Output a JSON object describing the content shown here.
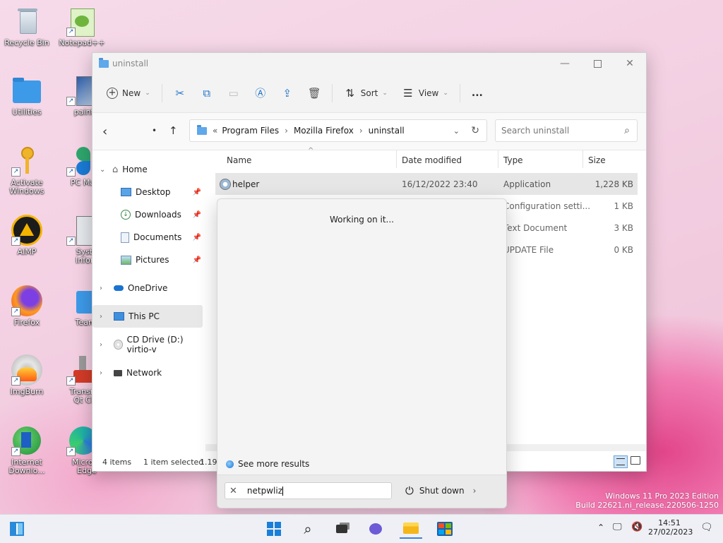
{
  "desktop": {
    "icons": [
      {
        "label": "Recycle Bin"
      },
      {
        "label": "Notepad++"
      },
      {
        "label": "Utilities"
      },
      {
        "label": "paint.n"
      },
      {
        "label": "Activate Windows"
      },
      {
        "label": "PC Mana"
      },
      {
        "label": "AIMP"
      },
      {
        "label": "Syster Inform"
      },
      {
        "label": "Firefox"
      },
      {
        "label": "TeamC"
      },
      {
        "label": "ImgBurn"
      },
      {
        "label": "Transmis Qt Clie"
      },
      {
        "label": "Internet Downlo..."
      },
      {
        "label": "Microso Edge"
      }
    ],
    "watermark": {
      "line1": "Windows 11 Pro 2023 Edition",
      "line2": "Build 22621.ni_release.220506-1250"
    }
  },
  "explorer": {
    "title": "uninstall",
    "toolbar": {
      "new_label": "New",
      "sort_label": "Sort",
      "view_label": "View",
      "more_label": "..."
    },
    "breadcrumb": [
      "Program Files",
      "Mozilla Firefox",
      "uninstall"
    ],
    "breadcrumb_prefix": "«",
    "search_placeholder": "Search uninstall",
    "nav": {
      "home": "Home",
      "desktop": "Desktop",
      "downloads": "Downloads",
      "documents": "Documents",
      "pictures": "Pictures",
      "onedrive": "OneDrive",
      "thispc": "This PC",
      "cddrive": "CD Drive (D:) virtio-v",
      "network": "Network"
    },
    "columns": {
      "name": "Name",
      "date": "Date modified",
      "type": "Type",
      "size": "Size"
    },
    "files": [
      {
        "name": "helper",
        "date": "16/12/2022 23:40",
        "type": "Application",
        "size": "1,228 KB"
      },
      {
        "name": "",
        "date": "",
        "type": "Configuration setti...",
        "size": "1 KB"
      },
      {
        "name": "",
        "date": "",
        "type": "Text Document",
        "size": "3 KB"
      },
      {
        "name": "",
        "date": "",
        "type": "UPDATE File",
        "size": "0 KB"
      }
    ],
    "status": {
      "items": "4 items",
      "selected": "1 item selected",
      "size_partial": "1.19"
    }
  },
  "search_flyout": {
    "working": "Working on it...",
    "see_more": "See more results",
    "query": "netpwliz",
    "shutdown": "Shut down"
  },
  "taskbar": {
    "time": "14:51",
    "date": "27/02/2023"
  }
}
